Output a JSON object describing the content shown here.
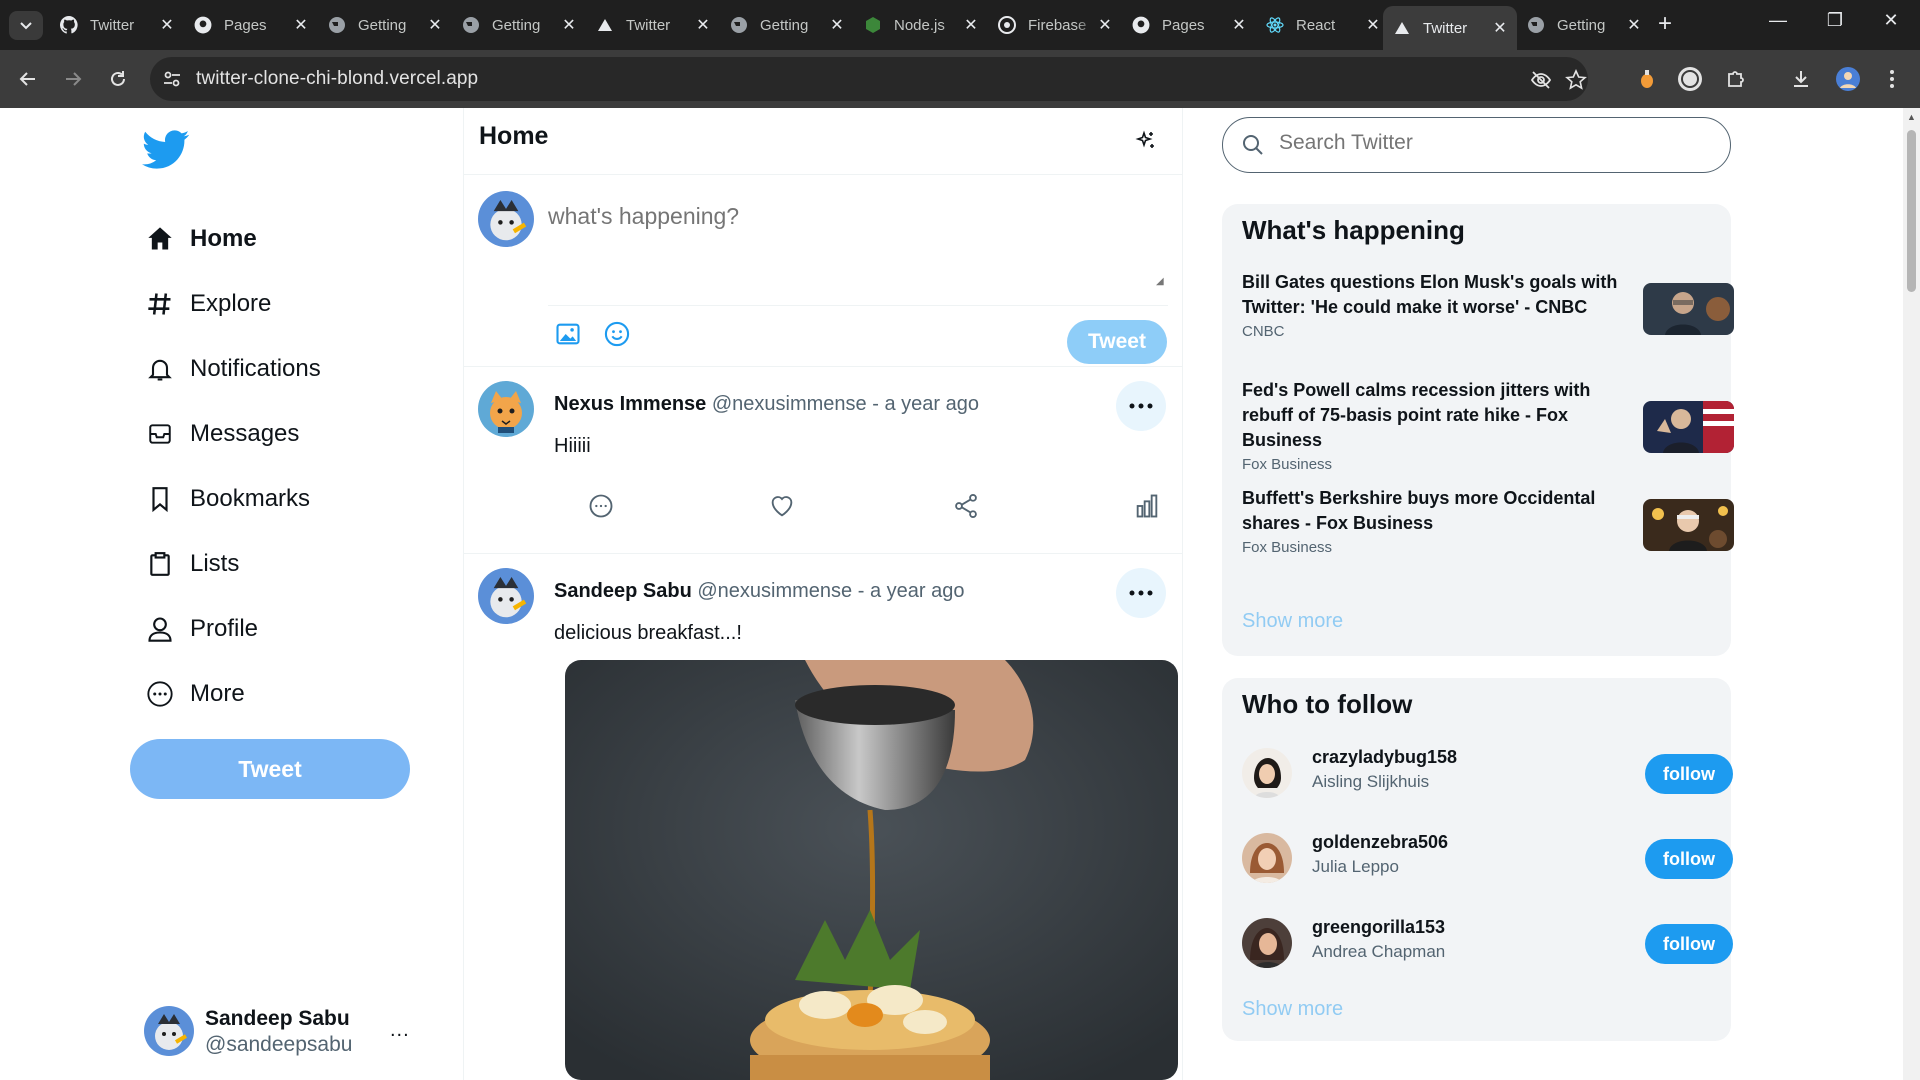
{
  "browser": {
    "tabs": [
      {
        "title": "Twitter",
        "icon": "github-icon"
      },
      {
        "title": "Pages",
        "icon": "github-icon"
      },
      {
        "title": "Getting",
        "icon": "globe-icon"
      },
      {
        "title": "Getting",
        "icon": "globe-icon"
      },
      {
        "title": "Twitter",
        "icon": "vercel-icon"
      },
      {
        "title": "Getting",
        "icon": "globe-icon"
      },
      {
        "title": "Node.js",
        "icon": "nodejs-icon"
      },
      {
        "title": "Firebase",
        "icon": "firebase-icon"
      },
      {
        "title": "Pages",
        "icon": "github-icon"
      },
      {
        "title": "React",
        "icon": "react-icon"
      },
      {
        "title": "Twitter",
        "icon": "vercel-icon",
        "active": true
      },
      {
        "title": "Getting",
        "icon": "globe-icon"
      }
    ],
    "url": "twitter-clone-chi-blond.vercel.app"
  },
  "sidebar": {
    "items": [
      {
        "label": "Home",
        "icon": "home-icon"
      },
      {
        "label": "Explore",
        "icon": "hashtag-icon"
      },
      {
        "label": "Notifications",
        "icon": "bell-icon"
      },
      {
        "label": "Messages",
        "icon": "mail-icon"
      },
      {
        "label": "Bookmarks",
        "icon": "bookmark-icon"
      },
      {
        "label": "Lists",
        "icon": "clipboard-icon"
      },
      {
        "label": "Profile",
        "icon": "person-icon"
      },
      {
        "label": "More",
        "icon": "more-circle-icon"
      }
    ],
    "tweet_button": "Tweet",
    "account": {
      "name": "Sandeep Sabu",
      "handle": "@sandeepsabu",
      "more": "..."
    }
  },
  "main": {
    "title": "Home",
    "composer": {
      "placeholder": "what's happening?",
      "tweet_button": "Tweet"
    },
    "posts": [
      {
        "name": "Nexus Immense",
        "handle": "@nexusimmense",
        "time": "- a year ago",
        "text": "Hiiiii"
      },
      {
        "name": "Sandeep Sabu",
        "handle": "@nexusimmense",
        "time": "- a year ago",
        "text": "delicious breakfast...!"
      }
    ]
  },
  "right": {
    "search_placeholder": "Search Twitter",
    "happening": {
      "title": "What's happening",
      "items": [
        {
          "headline": "Bill Gates questions Elon Musk's goals with Twitter: 'He could make it worse' - CNBC",
          "source": "CNBC"
        },
        {
          "headline": "Fed's Powell calms recession jitters with rebuff of 75-basis point rate hike - Fox Business",
          "source": "Fox Business"
        },
        {
          "headline": "Buffett's Berkshire buys more Occidental shares - Fox Business",
          "source": "Fox Business"
        }
      ],
      "show_more": "Show more"
    },
    "who_to_follow": {
      "title": "Who to follow",
      "users": [
        {
          "username": "crazyladybug158",
          "name": "Aisling Slijkhuis",
          "button": "follow"
        },
        {
          "username": "goldenzebra506",
          "name": "Julia Leppo",
          "button": "follow"
        },
        {
          "username": "greengorilla153",
          "name": "Andrea Chapman",
          "button": "follow"
        }
      ],
      "show_more": "Show more"
    }
  },
  "colors": {
    "accent": "#1d9bf0",
    "sidebar_tweet": "#7cb7f5",
    "composer_tweet": "#8ecdf8"
  }
}
